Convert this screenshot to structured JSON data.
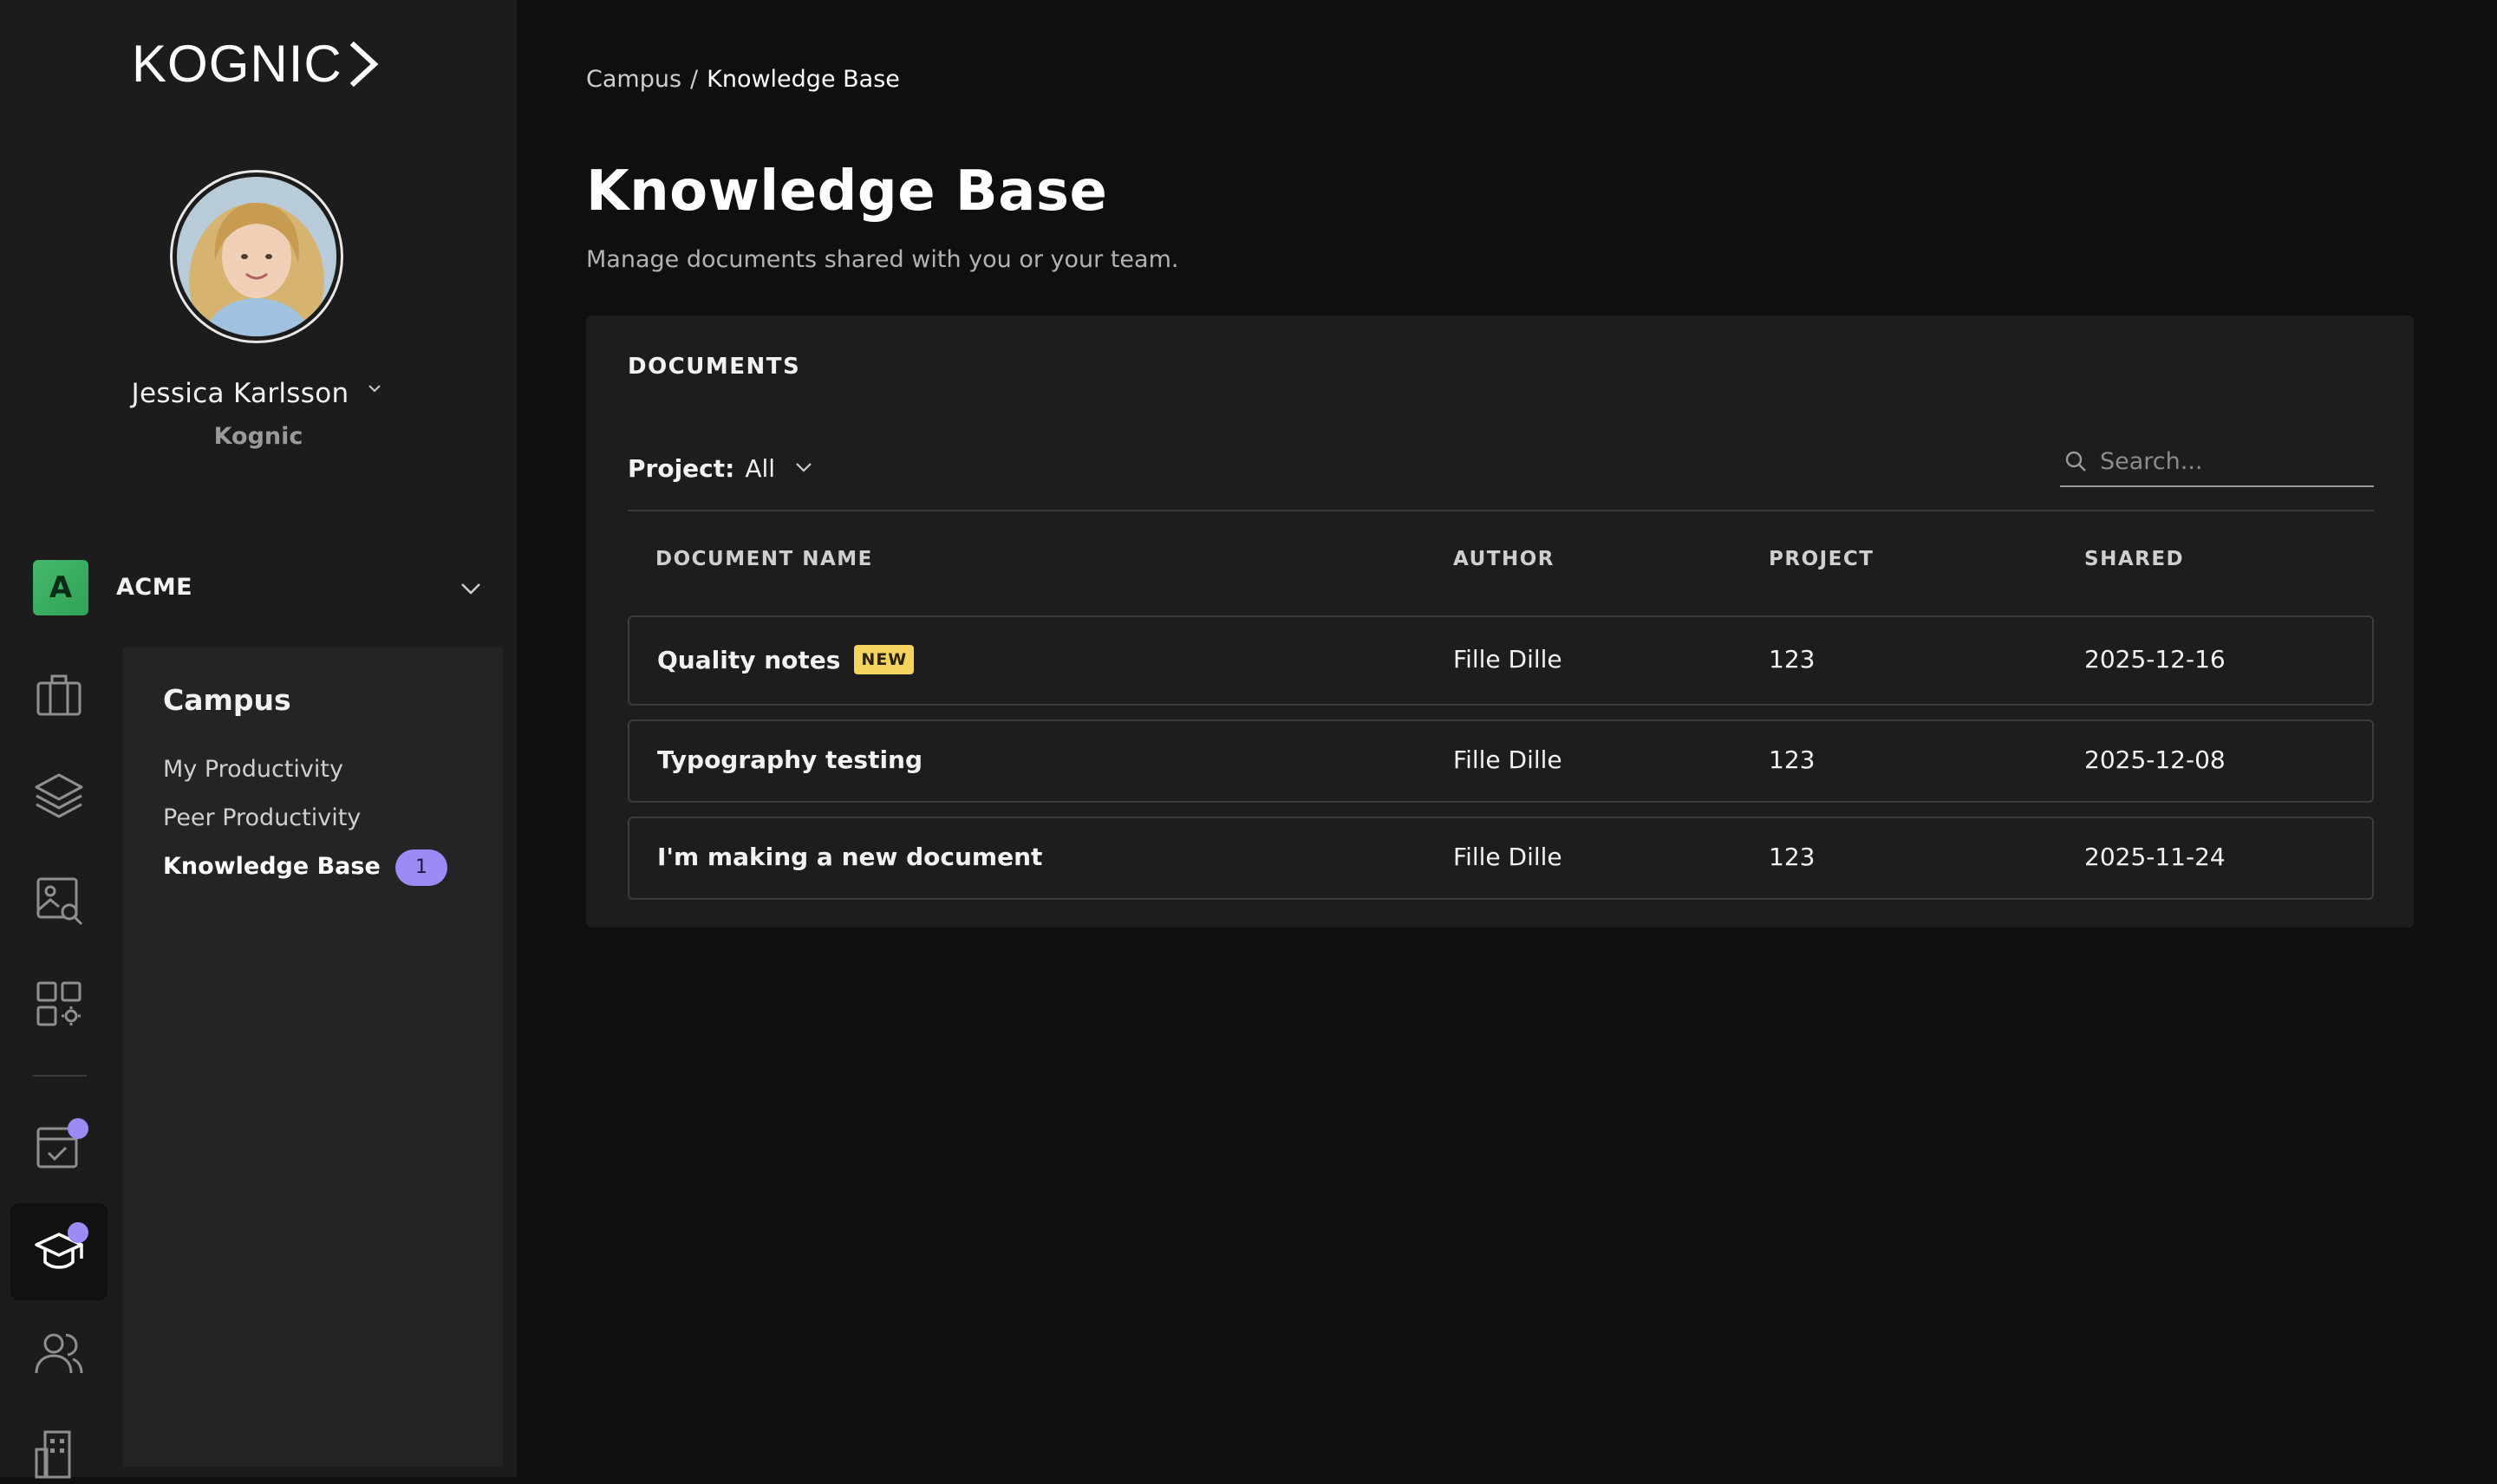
{
  "brand": {
    "logo_text": "KOGNIC"
  },
  "user": {
    "name": "Jessica Karlsson",
    "organization": "Kognic"
  },
  "workspace": {
    "initial": "A",
    "name": "ACME",
    "badge_color": "#45b86a"
  },
  "rail": {
    "icons": [
      "briefcase-icon",
      "layers-icon",
      "image-search-icon",
      "apps-settings-icon",
      "calendar-check-icon",
      "graduation-cap-icon",
      "users-icon",
      "building-settings-icon"
    ],
    "active": "graduation-cap-icon",
    "notification_color": "#9b8cf5"
  },
  "subnav": {
    "title": "Campus",
    "items": [
      {
        "label": "My Productivity"
      },
      {
        "label": "Peer Productivity"
      },
      {
        "label": "Knowledge Base",
        "badge": "1"
      }
    ]
  },
  "breadcrumb": {
    "parent": "Campus",
    "separator": "/",
    "current": "Knowledge Base"
  },
  "page": {
    "title": "Knowledge Base",
    "subtitle": "Manage documents shared with you or your team."
  },
  "documents": {
    "heading": "DOCUMENTS",
    "filter_label": "Project:",
    "filter_value": "All",
    "search_placeholder": "Search...",
    "columns": [
      "DOCUMENT NAME",
      "AUTHOR",
      "PROJECT",
      "SHARED"
    ],
    "rows": [
      {
        "name": "Quality notes",
        "badge": "NEW",
        "author": "Fille Dille",
        "project": "123",
        "shared": "2025-12-16"
      },
      {
        "name": "Typography testing",
        "author": "Fille Dille",
        "project": "123",
        "shared": "2025-12-08"
      },
      {
        "name": "I'm making a new document",
        "author": "Fille Dille",
        "project": "123",
        "shared": "2025-11-24"
      }
    ],
    "badge_color": "#f4d35e"
  }
}
